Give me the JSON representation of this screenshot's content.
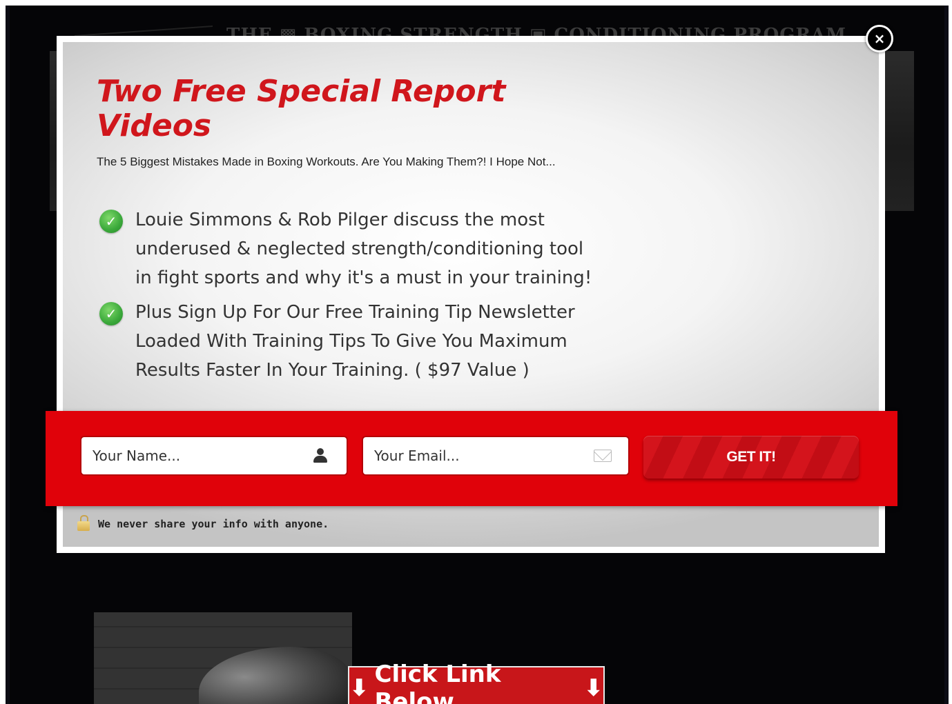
{
  "background": {
    "banner_text": "THE ▩ BOXING STRENGTH ▣ CONDITIONING PROGRAM",
    "click_banner_label": "Click Link Below"
  },
  "popup": {
    "close_label": "×",
    "headline": "Two Free Special Report Videos",
    "subheadline": "The 5 Biggest Mistakes Made in Boxing Workouts. Are You Making Them?! I Hope Not...",
    "bullets": [
      {
        "icon": "check-icon",
        "text": "Louie Simmons & Rob Pilger discuss the most underused & neglected strength/conditioning tool in fight sports and why it's a must in your training!"
      },
      {
        "icon": "check-icon",
        "text": "Plus Sign Up For Our Free Training Tip Newsletter Loaded With Training Tips To Give You Maximum Results Faster In Your Training. ( $97 Value )"
      }
    ],
    "form": {
      "name_placeholder": "Your Name...",
      "email_placeholder": "Your Email...",
      "submit_label": "GET IT!"
    },
    "privacy_note": "We never share your info with anyone."
  },
  "colors": {
    "accent_red": "#e0020a",
    "headline_red": "#d0161c",
    "check_green": "#3aa83a",
    "page_background": "#050507"
  }
}
